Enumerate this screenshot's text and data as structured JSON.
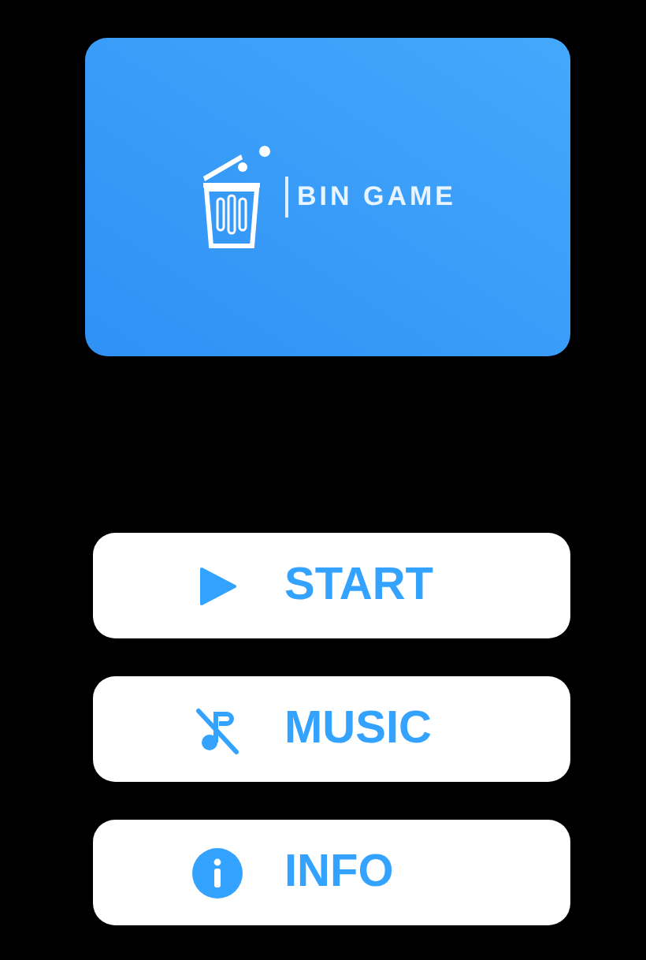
{
  "logo": {
    "title": "BIN GAME"
  },
  "buttons": [
    {
      "kind": "play",
      "label": "START"
    },
    {
      "kind": "music_off",
      "label": "MUSIC"
    },
    {
      "kind": "info",
      "label": "INFO"
    }
  ]
}
